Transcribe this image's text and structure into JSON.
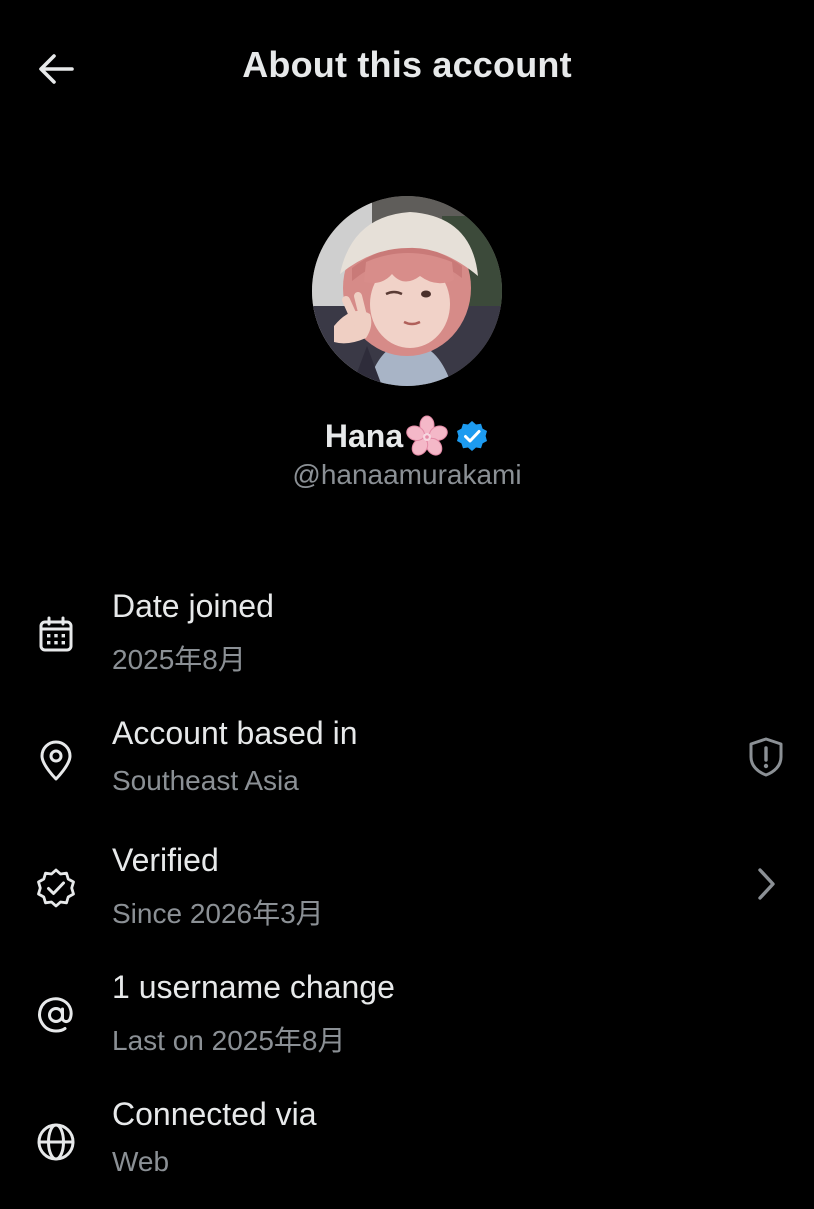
{
  "header": {
    "title": "About this account",
    "back_icon": "arrow-left-icon"
  },
  "profile": {
    "display_name": "Hana",
    "name_emoji": "🌸",
    "verified": true,
    "handle": "@hanaamurakami",
    "avatar": "profile-photo"
  },
  "info_rows": [
    {
      "icon": "calendar-icon",
      "title": "Date joined",
      "subtitle": "2025年8月",
      "trailing": ""
    },
    {
      "icon": "location-pin-icon",
      "title": "Account based in",
      "subtitle": "Southeast Asia",
      "trailing": "shield-alert-icon"
    },
    {
      "icon": "verified-check-icon",
      "title": "Verified",
      "subtitle": "Since 2026年3月",
      "trailing": "chevron-right-icon"
    },
    {
      "icon": "at-sign-icon",
      "title": "1 username change",
      "subtitle": "Last on 2025年8月",
      "trailing": ""
    },
    {
      "icon": "globe-icon",
      "title": "Connected via",
      "subtitle": "Web",
      "trailing": ""
    }
  ],
  "colors": {
    "background": "#000000",
    "primary_text": "#e7e9ea",
    "secondary_text": "#8b9095",
    "verified_blue": "#1d9bf0"
  }
}
